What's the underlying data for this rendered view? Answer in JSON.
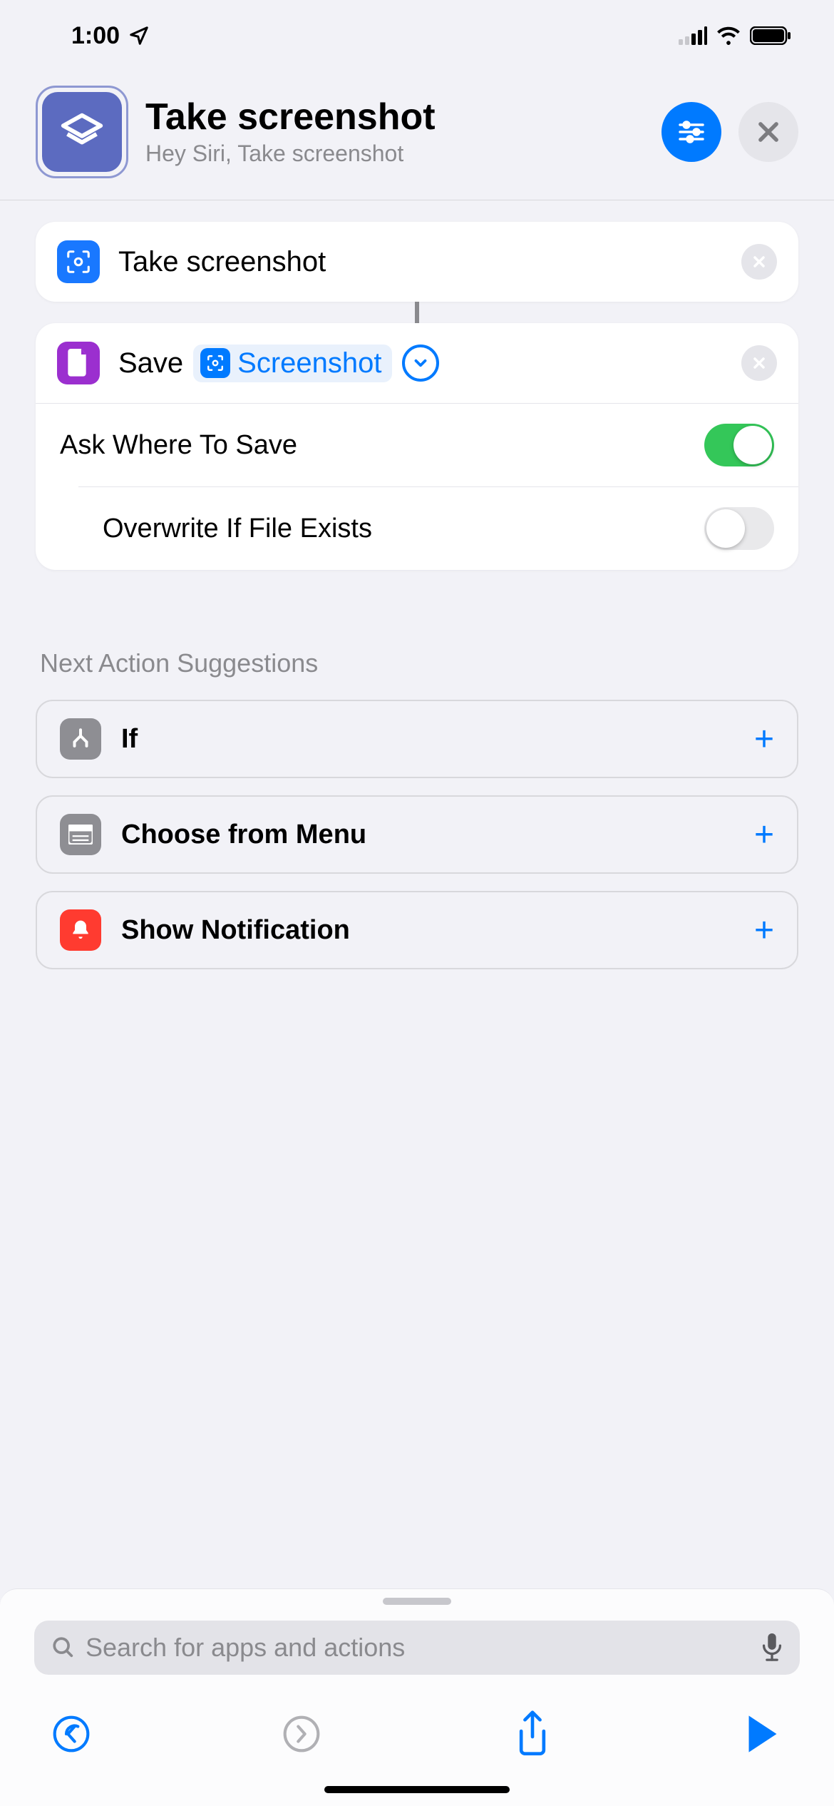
{
  "status_bar": {
    "time": "1:00"
  },
  "header": {
    "title": "Take screenshot",
    "subtitle": "Hey Siri, Take screenshot"
  },
  "actions": {
    "take_screenshot": {
      "label": "Take screenshot"
    },
    "save": {
      "label": "Save",
      "variable": "Screenshot",
      "options": {
        "ask_where": {
          "label": "Ask Where To Save",
          "on": true
        },
        "overwrite": {
          "label": "Overwrite If File Exists",
          "on": false
        }
      }
    }
  },
  "suggestions": {
    "heading": "Next Action Suggestions",
    "items": [
      {
        "label": "If"
      },
      {
        "label": "Choose from Menu"
      },
      {
        "label": "Show Notification"
      }
    ]
  },
  "search": {
    "placeholder": "Search for apps and actions"
  }
}
